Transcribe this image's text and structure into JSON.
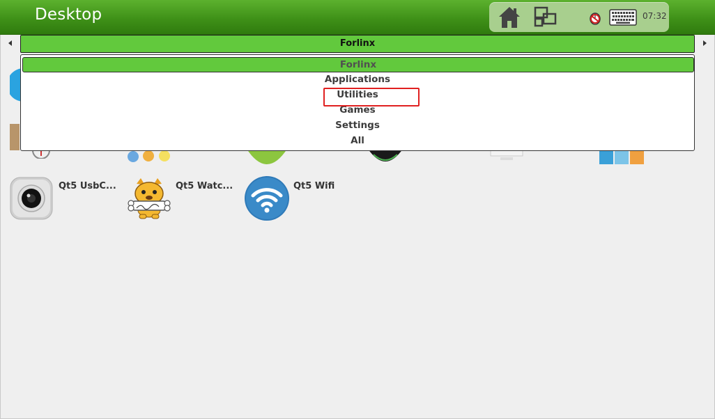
{
  "header": {
    "title": "Desktop",
    "clock": "07:32"
  },
  "category_bar": {
    "selected": "Forlinx"
  },
  "dropdown": {
    "items": [
      {
        "label": "Forlinx",
        "selected": true
      },
      {
        "label": "Applications",
        "selected": false
      },
      {
        "label": "Utilities",
        "selected": false,
        "highlighted": true
      },
      {
        "label": "Games",
        "selected": false
      },
      {
        "label": "Settings",
        "selected": false
      },
      {
        "label": "All",
        "selected": false
      }
    ]
  },
  "apps": [
    {
      "label": "Qt5 UsbC...",
      "icon": "camera-icon"
    },
    {
      "label": "Qt5 Watc...",
      "icon": "watchdog-icon"
    },
    {
      "label": "Qt5 Wifi",
      "icon": "wifi-icon"
    }
  ],
  "colors": {
    "topbar": "#3f9118",
    "selected_green": "#62c93d",
    "highlight_red": "#e02020",
    "wifi_blue": "#2f7ab8"
  }
}
